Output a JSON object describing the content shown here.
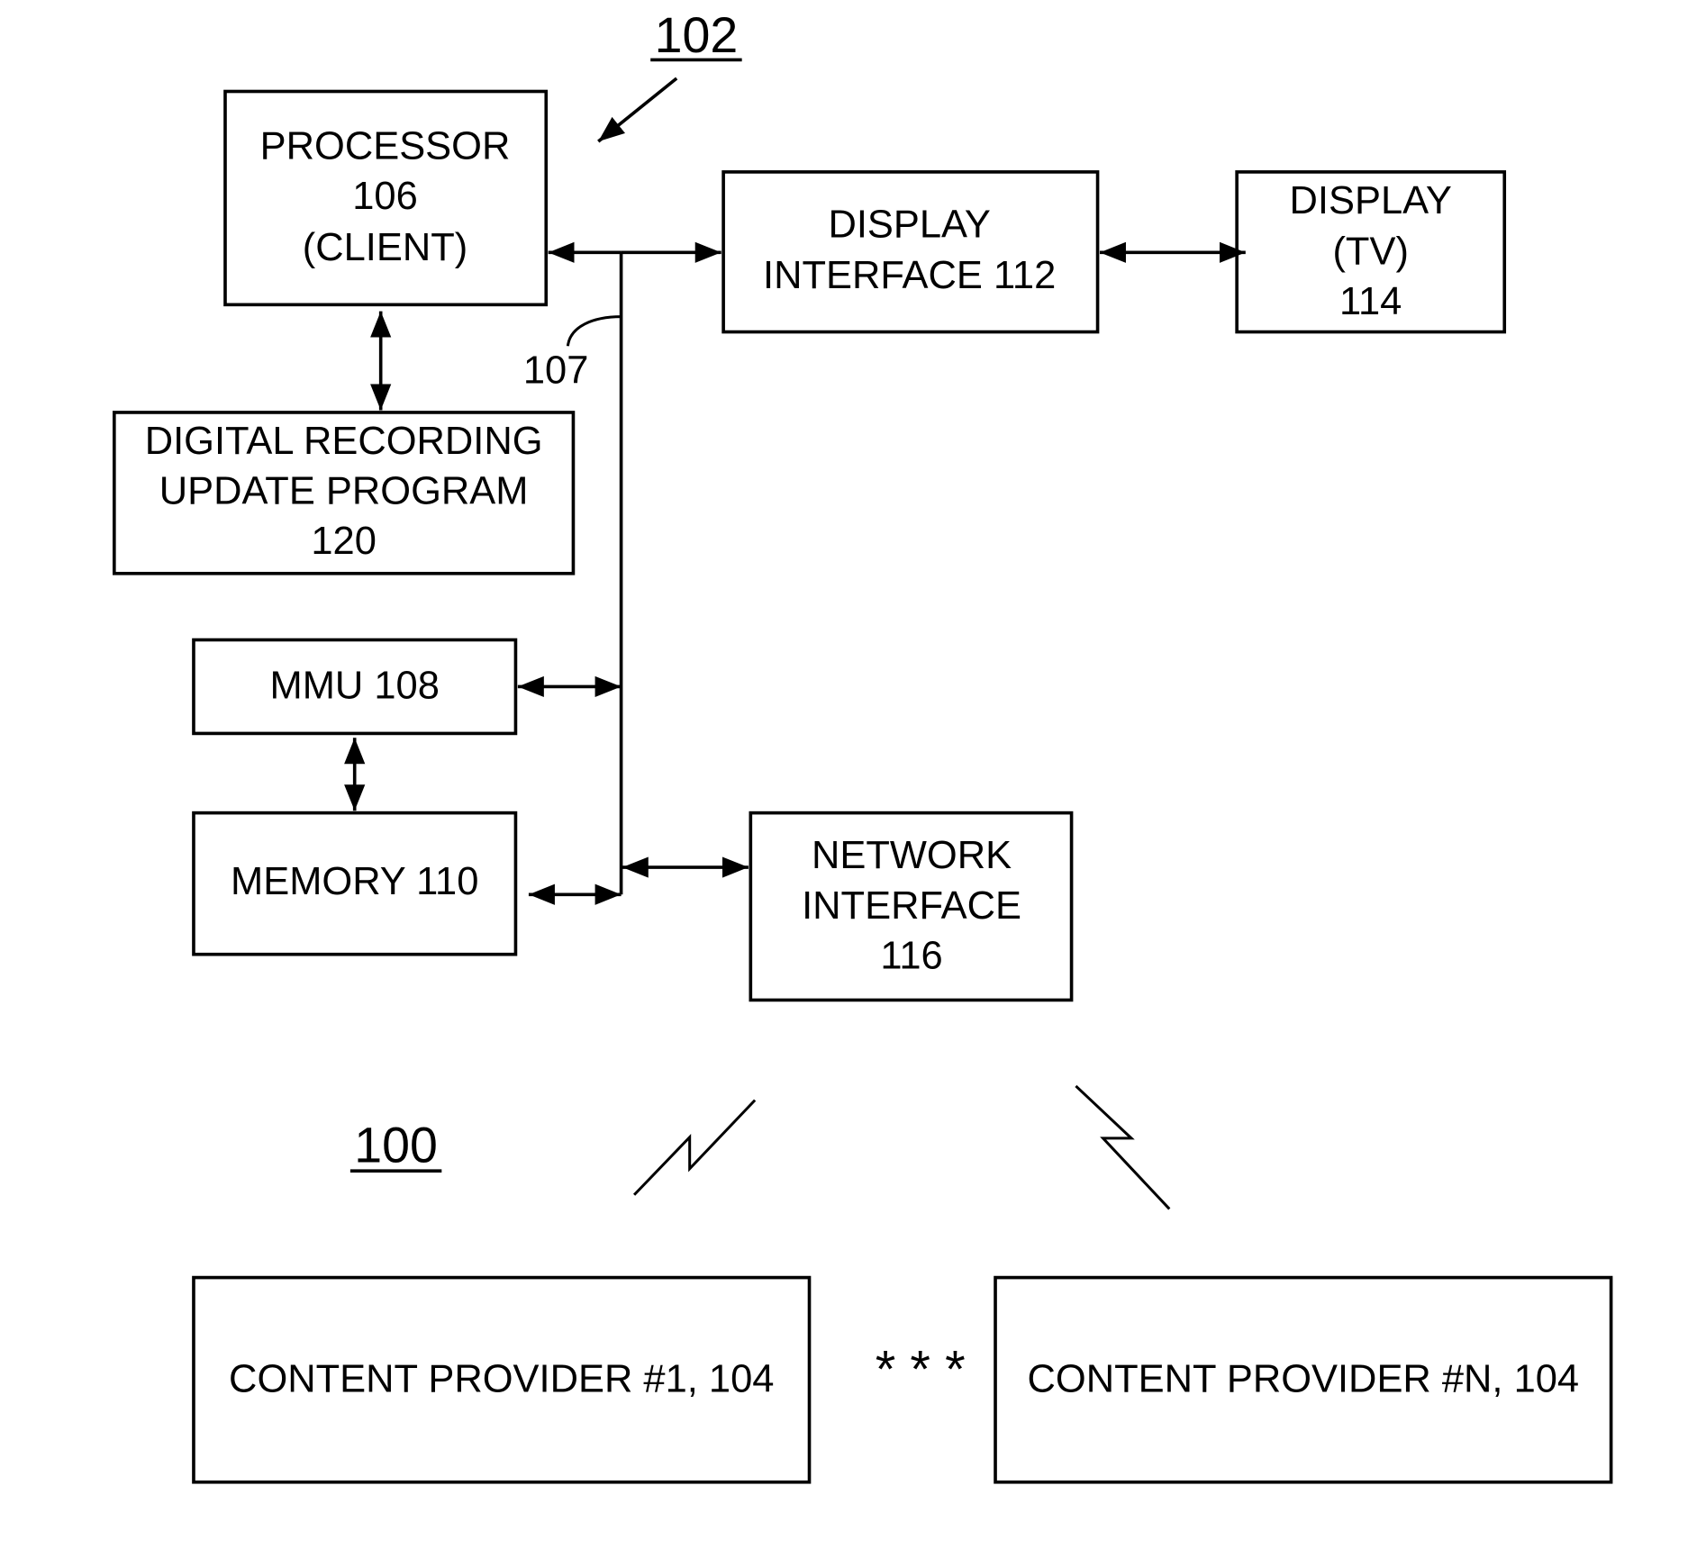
{
  "figure": {
    "system_ref": "100",
    "client_ref": "102",
    "bus_ref": "107",
    "ellipsis": "* * *"
  },
  "blocks": {
    "processor": {
      "lines": [
        "PROCESSOR",
        "106",
        "(CLIENT)"
      ]
    },
    "display_interface": {
      "lines": [
        "DISPLAY",
        "INTERFACE 112"
      ]
    },
    "display_tv": {
      "lines": [
        "DISPLAY",
        "(TV)",
        "114"
      ]
    },
    "recording_program": {
      "lines": [
        "DIGITAL RECORDING",
        "UPDATE PROGRAM",
        "120"
      ]
    },
    "mmu": {
      "lines": [
        "MMU 108"
      ]
    },
    "memory": {
      "lines": [
        "MEMORY 110"
      ]
    },
    "network_interface": {
      "lines": [
        "NETWORK",
        "INTERFACE",
        "116"
      ]
    },
    "content_provider_1": {
      "lines": [
        "CONTENT PROVIDER #1, 104"
      ]
    },
    "content_provider_n": {
      "lines": [
        "CONTENT PROVIDER #N, 104"
      ]
    }
  }
}
